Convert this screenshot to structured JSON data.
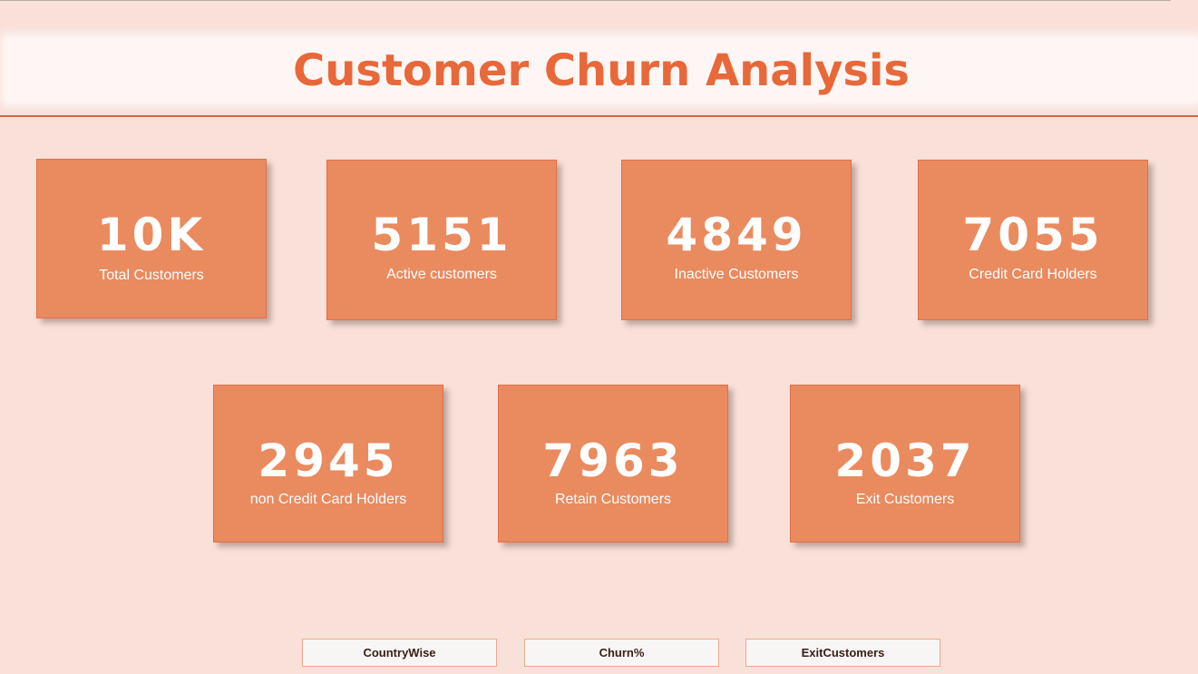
{
  "header": {
    "title": "Customer Churn Analysis"
  },
  "kpi_cards": [
    {
      "value": "10K",
      "label": "Total Customers"
    },
    {
      "value": "5151",
      "label": "Active customers"
    },
    {
      "value": "4849",
      "label": "Inactive Customers"
    },
    {
      "value": "7055",
      "label": "Credit Card Holders"
    },
    {
      "value": "2945",
      "label": "non Credit Card Holders"
    },
    {
      "value": "7963",
      "label": "Retain Customers"
    },
    {
      "value": "2037",
      "label": "Exit Customers"
    }
  ],
  "nav_buttons": [
    {
      "label": "CountryWise"
    },
    {
      "label": "Churn%"
    },
    {
      "label": "ExitCustomers"
    }
  ],
  "colors": {
    "background": "#f9e1da",
    "accent": "#e8683a",
    "card_fill": "#ea8a5f",
    "divider": "#cf6844"
  }
}
